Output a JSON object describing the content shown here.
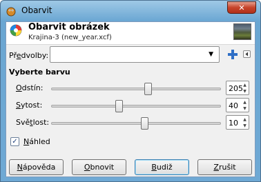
{
  "window": {
    "title": "Obarvit",
    "close_glyph": "✕"
  },
  "header": {
    "title": "Obarvit obrázek",
    "subtitle": "Krajina-3 (new_year.xcf)"
  },
  "presets": {
    "label_before": "Př",
    "label_acc": "e",
    "label_after": "dvolby:",
    "value": "",
    "arrow": "▼",
    "add_glyph": "+",
    "menu_glyph": "◂"
  },
  "section": {
    "title": "Vyberte barvu"
  },
  "sliders": [
    {
      "label_before": "",
      "label_acc": "O",
      "label_after": "dstín:",
      "value": "205",
      "position": 0.57
    },
    {
      "label_before": "",
      "label_acc": "S",
      "label_after": "ytost:",
      "value": "40",
      "position": 0.4
    },
    {
      "label_before": "Svě",
      "label_acc": "t",
      "label_after": "lost:",
      "value": "10",
      "position": 0.55
    }
  ],
  "preview": {
    "checked": true,
    "check_glyph": "✓",
    "label_before": "",
    "label_acc": "N",
    "label_after": "áhled"
  },
  "buttons": [
    {
      "before": "",
      "acc": "N",
      "after": "ápověda"
    },
    {
      "before": "",
      "acc": "O",
      "after": "bnovit"
    },
    {
      "before": "",
      "acc": "B",
      "after": "udiž"
    },
    {
      "before": "",
      "acc": "Z",
      "after": "rušit"
    }
  ],
  "colors": {
    "accent": "#3c7fb1",
    "close": "#c6432a"
  }
}
